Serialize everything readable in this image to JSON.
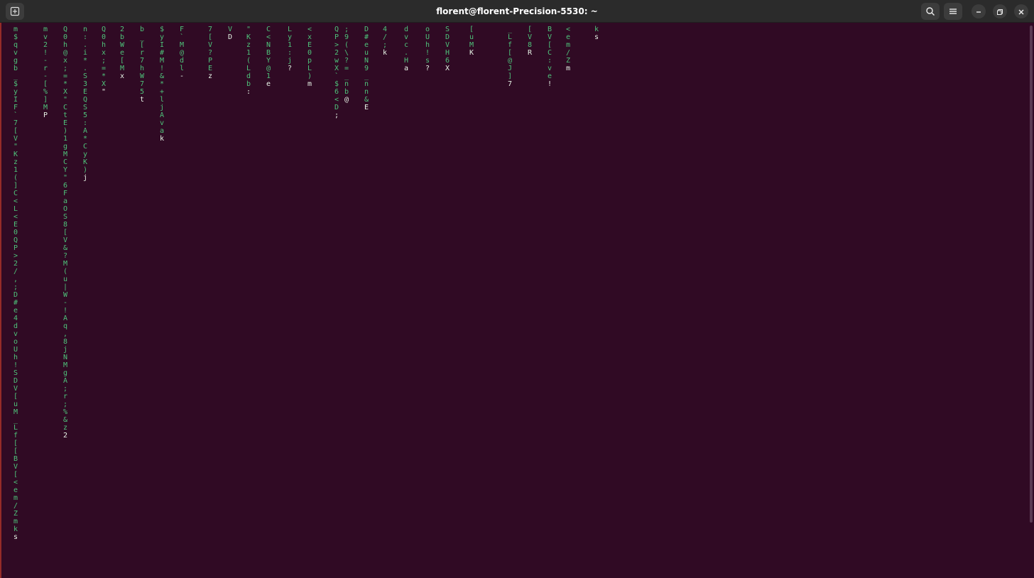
{
  "window": {
    "title": "florent@florent-Precision-5530: ~"
  },
  "icons": {
    "new_tab": "new-tab-icon",
    "search": "search-icon",
    "menu": "hamburger-menu-icon",
    "minimize": "minimize-icon",
    "maximize": "maximize-icon",
    "close": "close-icon"
  },
  "colors": {
    "background": "#300a24",
    "rain": "#4ec27a",
    "rain_head": "#e8f5e8",
    "titlebar": "#2b2b2b"
  },
  "terminal": {
    "columns": [
      "m$qvgb_$yIF`7[V\"Kz1(]C<L<E0QP>2/,;D#e4dvoUh!SDV[uM_Lf[[BV[<em/Zmks",
      "mv2!-r-[%]MP",
      "Q0h@x;=*X\"CtE)1gMCY\"6FaOS8[V&?M(u|W-!Aq,8jNMgA;r;%&z2",
      "n:.i*.S3EQS5:A*CyK)j",
      "Q0hx;=*X\"",
      "2bWe[Mx",
      "b_[r7hW75t",
      "$yI#M!&*+ljAvak",
      "F`M@dl-",
      "7[V?PEz",
      "VD",
      "\"Kz1(Ldb:",
      "C<NBY@1e",
      "Ly1:j?",
      "<xE0pL)m",
      "QP>2wX`$6<D;",
      ";9(\\?=_nb@",
      "D#euN9_nn&E",
      "4/;k",
      "dvc.Ha",
      "oUh!s?",
      "SDVH6X",
      "[uMK",
      "_Lf[@J]7",
      "[V8R",
      "BV[C:ve!",
      "<em/Zm",
      "ks"
    ]
  }
}
